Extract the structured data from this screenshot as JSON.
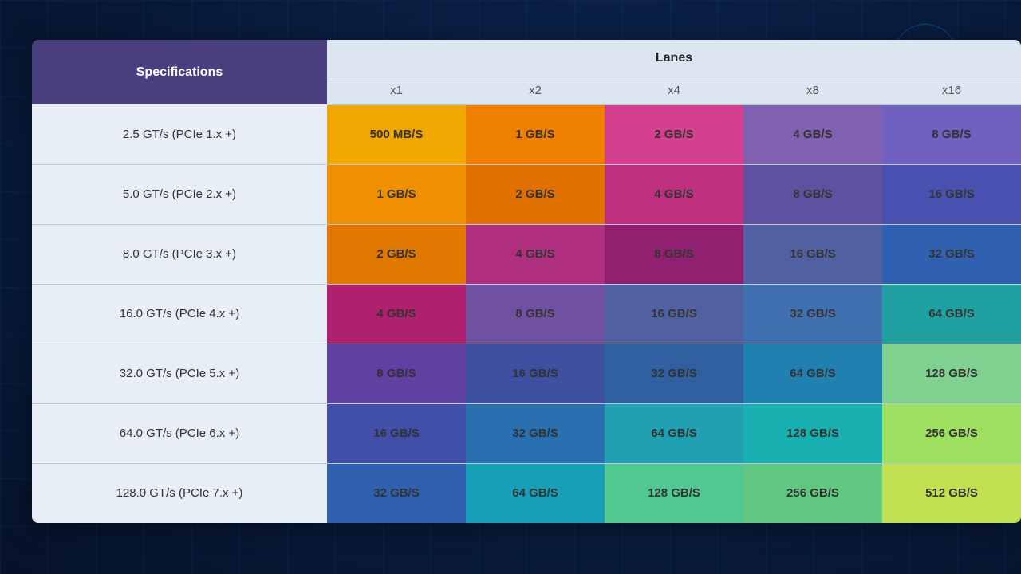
{
  "header": {
    "specs_label": "Specifications",
    "lanes_label": "Lanes",
    "cols": [
      "x1",
      "x2",
      "x4",
      "x8",
      "x16"
    ]
  },
  "rows": [
    {
      "spec": "2.5 GT/s (PCIe 1.x +)",
      "values": [
        "500 MB/S",
        "1 GB/S",
        "2 GB/S",
        "4 GB/S",
        "8 GB/S"
      ]
    },
    {
      "spec": "5.0 GT/s (PCIe 2.x +)",
      "values": [
        "1 GB/S",
        "2 GB/S",
        "4 GB/S",
        "8 GB/S",
        "16 GB/S"
      ]
    },
    {
      "spec": "8.0 GT/s (PCIe 3.x +)",
      "values": [
        "2 GB/S",
        "4 GB/S",
        "8 GB/S",
        "16 GB/S",
        "32 GB/S"
      ]
    },
    {
      "spec": "16.0 GT/s (PCIe 4.x +)",
      "values": [
        "4 GB/S",
        "8 GB/S",
        "16 GB/S",
        "32 GB/S",
        "64 GB/S"
      ]
    },
    {
      "spec": "32.0 GT/s (PCIe 5.x +)",
      "values": [
        "8 GB/S",
        "16 GB/S",
        "32 GB/S",
        "64 GB/S",
        "128 GB/S"
      ]
    },
    {
      "spec": "64.0 GT/s (PCIe 6.x +)",
      "values": [
        "16 GB/S",
        "32 GB/S",
        "64 GB/S",
        "128 GB/S",
        "256 GB/S"
      ]
    },
    {
      "spec": "128.0 GT/s (PCIe 7.x +)",
      "values": [
        "32 GB/S",
        "64 GB/S",
        "128 GB/S",
        "256 GB/S",
        "512 GB/S"
      ]
    }
  ]
}
